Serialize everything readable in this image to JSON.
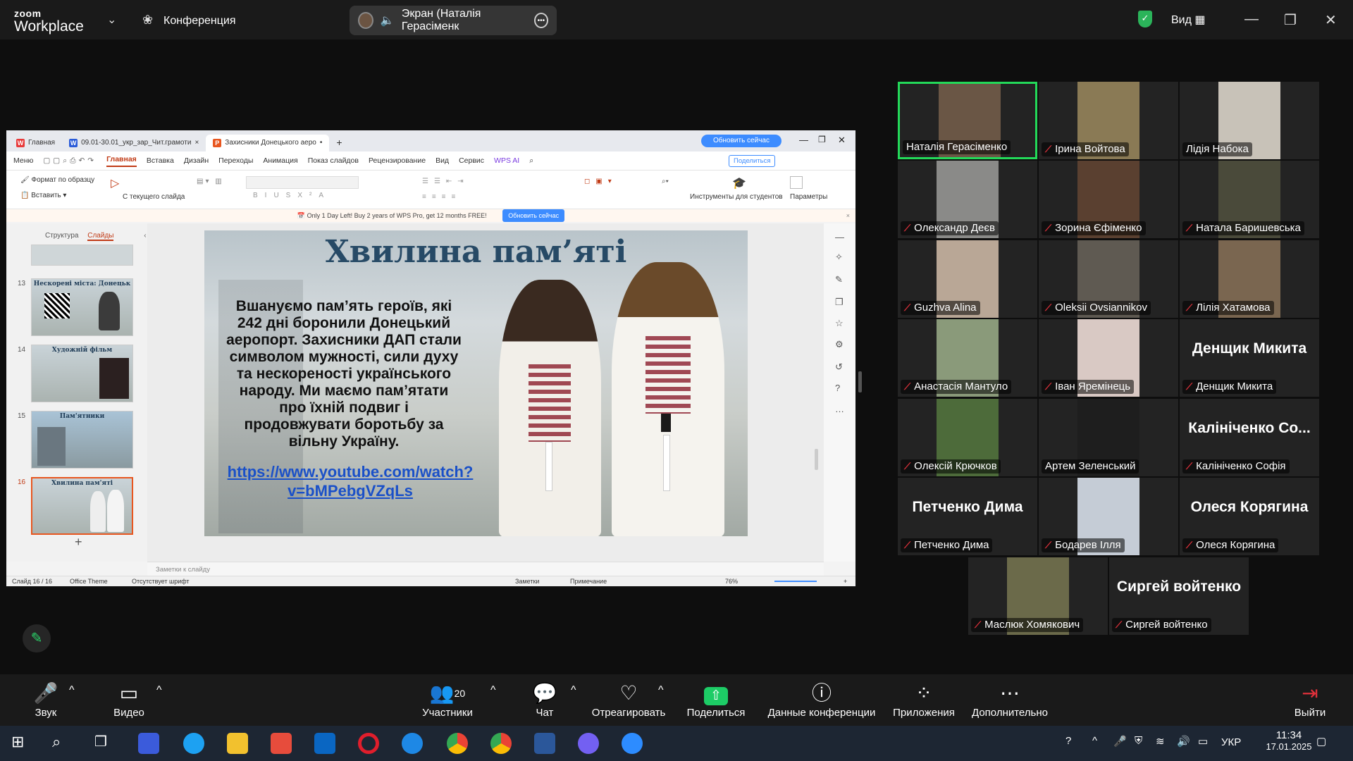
{
  "app": {
    "brand_top": "zoom",
    "brand_bottom": "Workplace",
    "menu_label": "Конференция",
    "view_label": "Вид"
  },
  "share_indicator": {
    "label": "Экран (Наталія Герасіменк"
  },
  "wps": {
    "tabs": [
      {
        "label": "Главная",
        "color": "#e83a3a",
        "icon": "W"
      },
      {
        "label": "09.01-30.01_укр_зар_Чит.грамоти",
        "color": "#2b5cd9",
        "icon": "W"
      },
      {
        "label": "Захисники Донецького аеро",
        "color": "#e8561f",
        "icon": "P"
      }
    ],
    "update_button": "Обновить сейчас",
    "menu": [
      "Меню",
      "Главная",
      "Вставка",
      "Дизайн",
      "Переходы",
      "Анимация",
      "Показ слайдов",
      "Рецензирование",
      "Вид",
      "Сервис",
      "WPS AI"
    ],
    "share_label": "Поделиться",
    "ribbon": {
      "format_painter": "Формат по образцу",
      "paste": "Вставить",
      "from_current": "С текущего слайда",
      "tools_students": "Инструменты для студентов",
      "params": "Параметры"
    },
    "promo": {
      "text": "Only 1 Day Left! Buy 2 years of WPS Pro, get 12 months FREE!",
      "button": "Обновить сейчас"
    },
    "pane_tabs": {
      "structure": "Структура",
      "slides": "Слайды"
    },
    "thumbs": [
      {
        "num": "13",
        "title": "Нескорені міста: Донецьк"
      },
      {
        "num": "14",
        "title": "Художній фільм"
      },
      {
        "num": "15",
        "title": "Пам'ятники"
      },
      {
        "num": "16",
        "title": "Хвилина пам'яті"
      }
    ],
    "slide": {
      "title": "Хвилина пам’яті",
      "body": "Вшануємо пам’ять героїв, які 242 дні боронили Донецький аеропорт. Захисники ДАП стали символом мужності, сили духу та нескореності українського народу. Ми маємо пам’ятати про їхній подвиг і продовжувати боротьбу за вільну Україну.",
      "link_line1": "https://www.youtube.com/watch?",
      "link_line2": "v=bMPebgVZqLs"
    },
    "notes_placeholder": "Заметки к слайду",
    "status": {
      "slide_info": "Слайд 16 / 16",
      "theme": "Office Theme",
      "font_warning": "Отсутствует шрифт",
      "notes": "Заметки",
      "comment": "Примечание",
      "zoom": "76%"
    }
  },
  "gallery": [
    {
      "name": "Наталія Герасіменко",
      "muted": false,
      "speaking": true,
      "video": true,
      "bg": "#6a5645"
    },
    {
      "name": "Ірина Войтова",
      "muted": true,
      "speaking": false,
      "video": true,
      "bg": "#8a7a55"
    },
    {
      "name": "Лідія Набока",
      "muted": false,
      "speaking": false,
      "video": true,
      "bg": "#c8c2b8"
    },
    {
      "name": "Олександр Деєв",
      "muted": true,
      "speaking": false,
      "video": true,
      "bg": "#8a8a88"
    },
    {
      "name": "Зорина  Єфіменко",
      "muted": true,
      "speaking": false,
      "video": true,
      "bg": "#5a4030"
    },
    {
      "name": "Натала Баришевська",
      "muted": true,
      "speaking": false,
      "video": true,
      "bg": "#4a4a3a"
    },
    {
      "name": "Guzhva Alina",
      "muted": true,
      "speaking": false,
      "video": true,
      "bg": "#b9a796"
    },
    {
      "name": "Oleksii Ovsiannikov",
      "muted": true,
      "speaking": false,
      "video": true,
      "bg": "#5f5a52"
    },
    {
      "name": "Лілія Хатамова",
      "muted": true,
      "speaking": false,
      "video": true,
      "bg": "#7a6650"
    },
    {
      "name": "Анастасія Мантуло",
      "muted": true,
      "speaking": false,
      "video": true,
      "bg": "#8a9a7a"
    },
    {
      "name": "Іван Яремінець",
      "muted": true,
      "speaking": false,
      "video": true,
      "bg": "#d9c9c4"
    },
    {
      "name": "Денщик Микита",
      "muted": true,
      "speaking": false,
      "video": false,
      "big": "Денщик Микита"
    },
    {
      "name": "Олексій Крючков",
      "muted": true,
      "speaking": false,
      "video": true,
      "bg": "#4d6b3a"
    },
    {
      "name": "Артем Зеленський",
      "muted": false,
      "speaking": false,
      "video": true,
      "bg": "#1e1e1e"
    },
    {
      "name": "Калініченко Софія",
      "muted": true,
      "speaking": false,
      "video": false,
      "big": "Калініченко Со..."
    },
    {
      "name": "Петченко Дима",
      "muted": true,
      "speaking": false,
      "video": false,
      "big": "Петченко Дима"
    },
    {
      "name": "Бодарев Ілля",
      "muted": true,
      "speaking": false,
      "video": true,
      "bg": "#c5ccd6"
    },
    {
      "name": "Олеся Корягина",
      "muted": true,
      "speaking": false,
      "video": false,
      "big": "Олеся Корягина"
    },
    {
      "name": "Маслюк Хомякович",
      "muted": true,
      "speaking": false,
      "video": true,
      "bg": "#6b6a4a"
    },
    {
      "name": "Сиргей войтенко",
      "muted": true,
      "speaking": false,
      "video": false,
      "big": "Сиргей войтенко"
    }
  ],
  "toolbar": {
    "audio": "Звук",
    "video": "Видео",
    "participants": "Участники",
    "participants_count": "20",
    "chat": "Чат",
    "react": "Отреагировать",
    "share": "Поделиться",
    "info": "Данные конференции",
    "apps": "Приложения",
    "more": "Дополнительно",
    "leave": "Выйти"
  },
  "taskbar": {
    "lang": "УКР",
    "time": "11:34",
    "date": "17.01.2025"
  },
  "colors": {
    "accent_green": "#23d959",
    "mute_red": "#e0313b",
    "wps_red": "#c13b16",
    "link_blue": "#1a50c8"
  }
}
